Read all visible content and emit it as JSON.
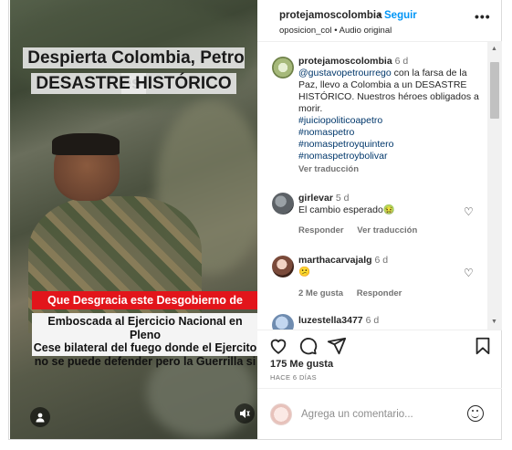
{
  "post": {
    "username": "protejamoscolombia",
    "follow_label": "Seguir",
    "subtitle": "oposicion_col • Audio original",
    "more_label": "•••"
  },
  "video": {
    "headline_1": "Despierta Colombia, Petro es",
    "headline_2": "DESASTRE HISTÓRICO",
    "red_banner": "Que Desgracia este Desgobierno de Petro",
    "caption_line_1": "Emboscada al Ejercicio Nacional en Pleno",
    "caption_line_2": "Cese bilateral del fuego donde el Ejercito",
    "caption_line_3": "no se puede defender pero la Guerrilla si"
  },
  "caption": {
    "username": "protejamoscolombia",
    "time": "6 d",
    "mention": "@gustavopetrourrego",
    "text": " con la farsa de la Paz, llevo a Colombia a un DESASTRE HISTÓRICO. Nuestros héroes obligados a morir.",
    "hashtags": [
      "#juiciopoliticoapetro",
      "#nomaspetro",
      "#nomaspetroyquintero",
      "#nomaspetroybolivar"
    ],
    "translate": "Ver traducción"
  },
  "comments": [
    {
      "username": "girlevar",
      "time": "5 d",
      "text": "El cambio esperado🤢",
      "reply": "Responder",
      "translate": "Ver traducción"
    },
    {
      "username": "marthacarvajalg",
      "time": "6 d",
      "text": "😕",
      "likes": "2 Me gusta",
      "reply": "Responder"
    },
    {
      "username": "luzestella3477",
      "time": "6 d"
    }
  ],
  "stats": {
    "likes": "175 Me gusta",
    "date": "HACE 6 DÍAS"
  },
  "composer": {
    "placeholder": "Agrega un comentario..."
  },
  "icons": {
    "like": "heart-icon",
    "comment": "comment-icon",
    "share": "send-icon",
    "save": "bookmark-icon",
    "emoji": "emoji-icon",
    "user": "user-icon",
    "mute": "speaker-icon"
  }
}
